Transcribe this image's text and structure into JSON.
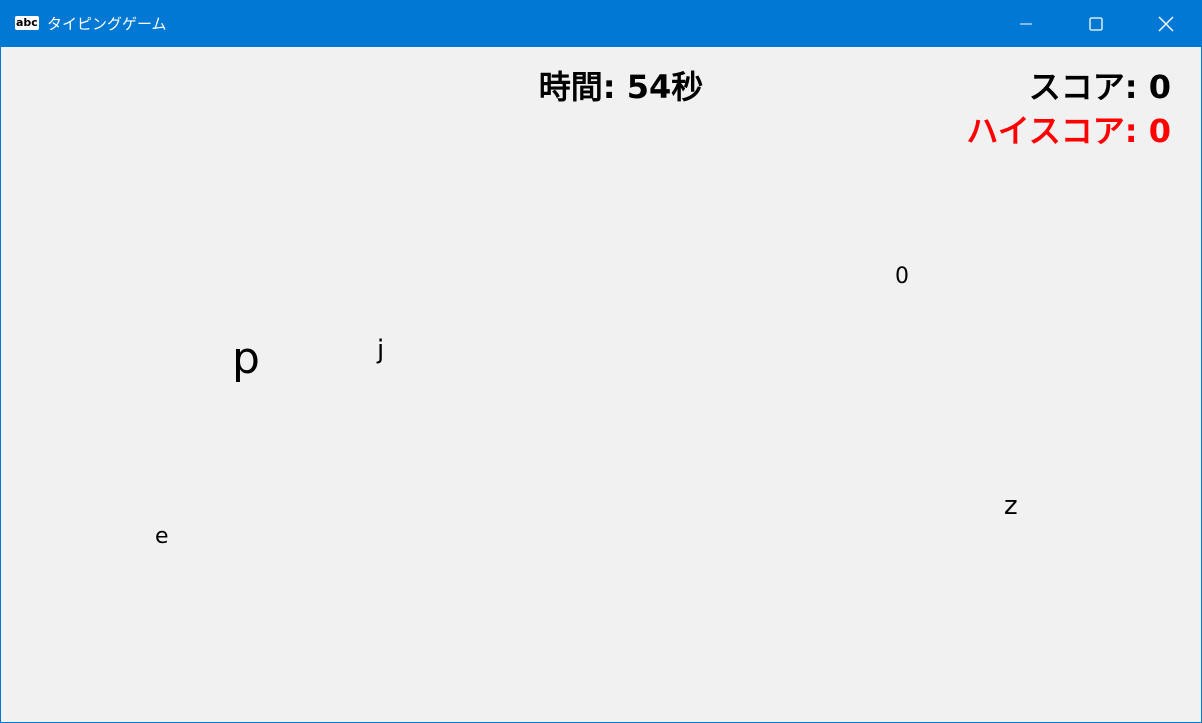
{
  "window": {
    "title": "タイピングゲーム",
    "icon": "abc"
  },
  "controls": {
    "minimize": "minimize-icon",
    "maximize": "maximize-icon",
    "close": "close-icon"
  },
  "hud": {
    "time": "時間: 54秒",
    "score": "スコア: 0",
    "highscore": "ハイスコア: 0"
  },
  "letters": [
    {
      "char": "0"
    },
    {
      "char": "p"
    },
    {
      "char": "j"
    },
    {
      "char": "z"
    },
    {
      "char": "e"
    }
  ],
  "colors": {
    "titlebar": "#0078d4",
    "background": "#f1f1f1",
    "highscore": "#ff0000"
  }
}
